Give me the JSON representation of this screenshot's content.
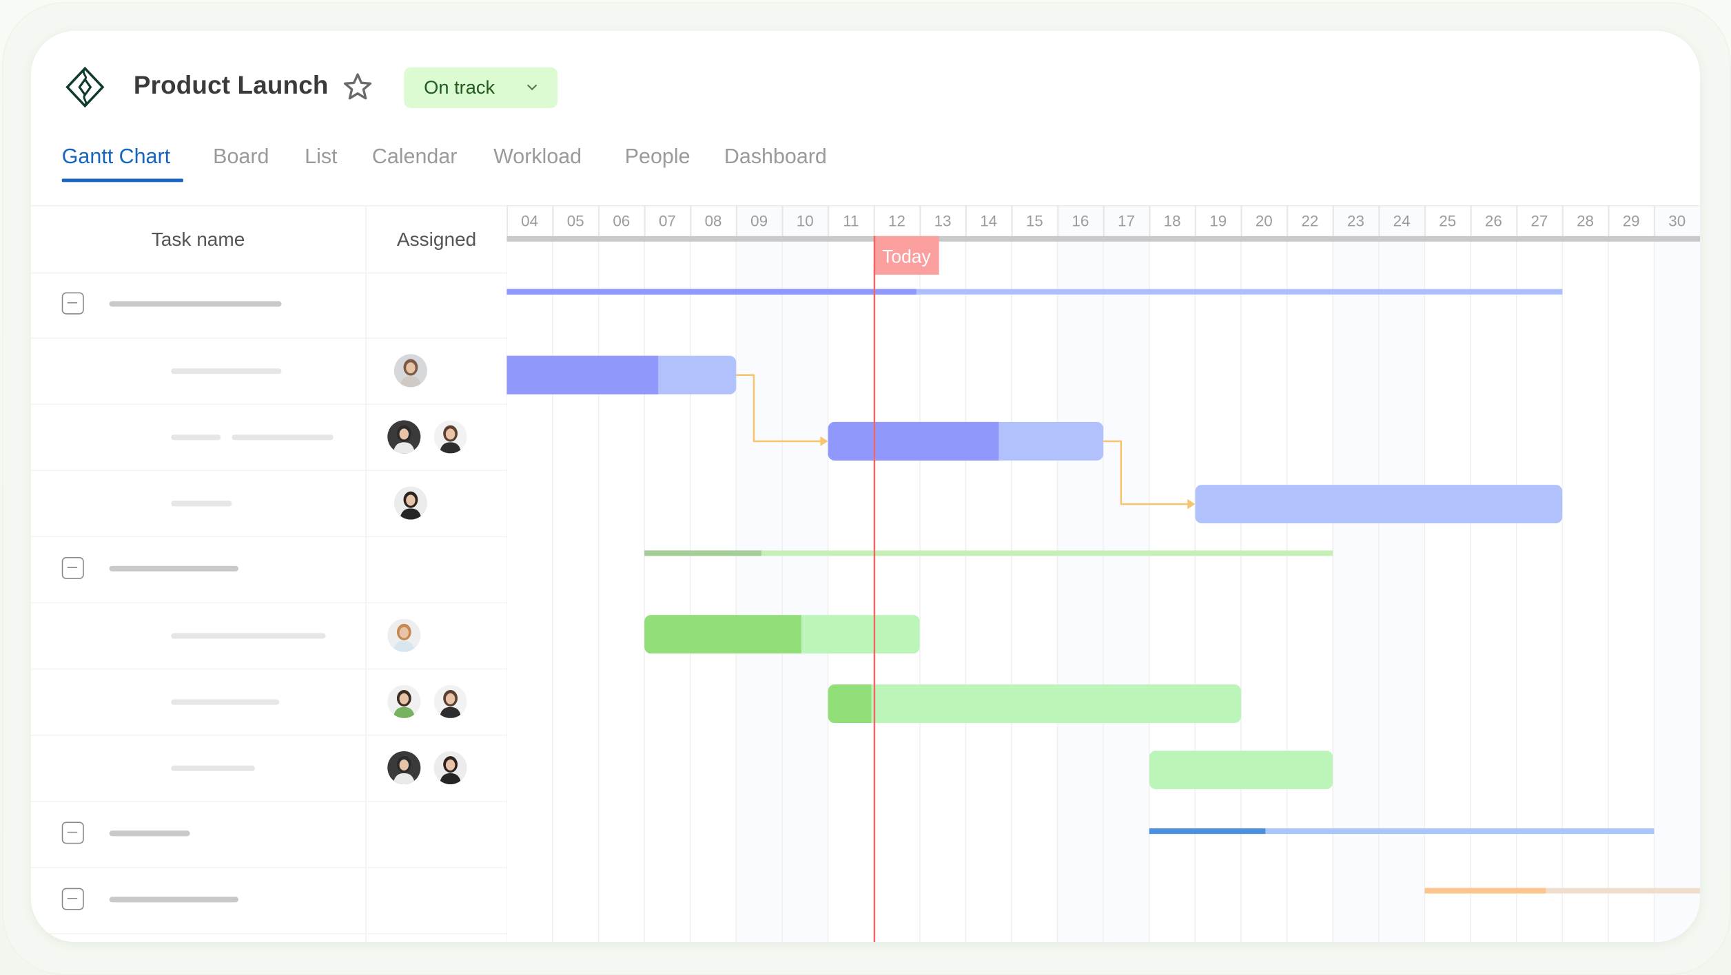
{
  "project": {
    "title": "Product Launch",
    "favorite": false,
    "status": {
      "label": "On track",
      "color": "#dcfbd3",
      "text_color": "#1f5a1f"
    },
    "logo_color": "#0e3b2e"
  },
  "tabs": [
    {
      "label": "Gantt Chart",
      "active": true
    },
    {
      "label": "Board",
      "active": false
    },
    {
      "label": "List",
      "active": false
    },
    {
      "label": "Calendar",
      "active": false
    },
    {
      "label": "Workload",
      "active": false
    },
    {
      "label": "People",
      "active": false
    },
    {
      "label": "Dashboard",
      "active": false
    }
  ],
  "table": {
    "headers": {
      "task": "Task name",
      "assigned": "Assigned"
    }
  },
  "chart_data": {
    "type": "gantt",
    "title": "",
    "days": [
      "04",
      "05",
      "06",
      "07",
      "08",
      "09",
      "10",
      "11",
      "12",
      "13",
      "14",
      "15",
      "16",
      "17",
      "18",
      "19",
      "20",
      "22",
      "23",
      "24",
      "25",
      "26",
      "27",
      "28",
      "29",
      "30"
    ],
    "weekend_days": [
      "09",
      "10",
      "16",
      "17",
      "23",
      "24",
      "30"
    ],
    "today": {
      "label": "Today",
      "day": "12",
      "color": "#fb9f9f",
      "line_color": "#f26565"
    },
    "rows": [
      {
        "kind": "section",
        "collapsed": false,
        "start": 0,
        "end": 23,
        "progress": 0.388,
        "done_color": "#9198fc",
        "todo_color": "#aec0fc"
      },
      {
        "kind": "task",
        "start": 0,
        "end": 5,
        "progress": 0.66,
        "assignees": [
          "avatar-1"
        ],
        "done_color": "#9198fc",
        "todo_color": "#b0c1fc"
      },
      {
        "kind": "task",
        "start": 7,
        "end": 13,
        "progress": 0.62,
        "assignees": [
          "avatar-2",
          "avatar-3"
        ],
        "done_color": "#9198fc",
        "todo_color": "#b0c1fc"
      },
      {
        "kind": "task",
        "start": 15,
        "end": 23,
        "progress": 0,
        "assignees": [
          "avatar-4"
        ],
        "done_color": "#9198fc",
        "todo_color": "#b0c1fc"
      },
      {
        "kind": "section",
        "collapsed": false,
        "start": 3,
        "end": 18,
        "progress": 0.17,
        "done_color": "#a5cd9a",
        "todo_color": "#c6f0b8"
      },
      {
        "kind": "task",
        "start": 3,
        "end": 9,
        "progress": 0.57,
        "assignees": [
          "avatar-5"
        ],
        "done_color": "#92de78",
        "todo_color": "#bbf5b9"
      },
      {
        "kind": "task",
        "start": 7,
        "end": 16,
        "progress": 0.105,
        "assignees": [
          "avatar-6",
          "avatar-3"
        ],
        "done_color": "#92de78",
        "todo_color": "#bbf5b9"
      },
      {
        "kind": "task",
        "start": 14,
        "end": 18,
        "progress": 0,
        "assignees": [
          "avatar-2",
          "avatar-4"
        ],
        "done_color": "#92de78",
        "todo_color": "#bbf5b9"
      },
      {
        "kind": "section",
        "collapsed": false,
        "start": 14,
        "end": 25,
        "progress": 0.23,
        "done_color": "#4a8fe0",
        "todo_color": "#a9c5fb"
      },
      {
        "kind": "section",
        "collapsed": false,
        "start": 20,
        "end": 26,
        "progress": 0.44,
        "done_color": "#fec48e",
        "todo_color": "#f1ddcc"
      }
    ],
    "dependencies": [
      {
        "from": 1,
        "to": 2
      },
      {
        "from": 2,
        "to": 3
      }
    ],
    "dependency_color": "#f8c46e"
  },
  "task_placeholders": [
    {
      "pills": [
        156
      ]
    },
    {
      "pills": [
        100
      ]
    },
    {
      "pills": [
        45,
        92
      ]
    },
    {
      "pills": [
        55
      ]
    },
    {
      "pills": [
        117
      ]
    },
    {
      "pills": [
        140
      ]
    },
    {
      "pills": [
        98
      ]
    },
    {
      "pills": [
        76
      ]
    },
    {
      "pills": [
        73
      ]
    },
    {
      "pills": [
        117
      ]
    }
  ],
  "avatars": {
    "avatar-1": {
      "bg": "#d7d8dc",
      "hair": "#7a5a45",
      "shirt": "#cfcac4"
    },
    "avatar-2": {
      "bg": "#3a3a3a",
      "hair": "#2a2a2a",
      "shirt": "#eaeaea"
    },
    "avatar-3": {
      "bg": "#f2f2f2",
      "hair": "#5b4030",
      "shirt": "#2e2e2e"
    },
    "avatar-4": {
      "bg": "#ececec",
      "hair": "#2b221d",
      "shirt": "#252525"
    },
    "avatar-5": {
      "bg": "#eeeeee",
      "hair": "#c7894f",
      "shirt": "#d8e6ef"
    },
    "avatar-6": {
      "bg": "#f0f0f0",
      "hair": "#3b2b22",
      "shirt": "#77b25f"
    }
  }
}
